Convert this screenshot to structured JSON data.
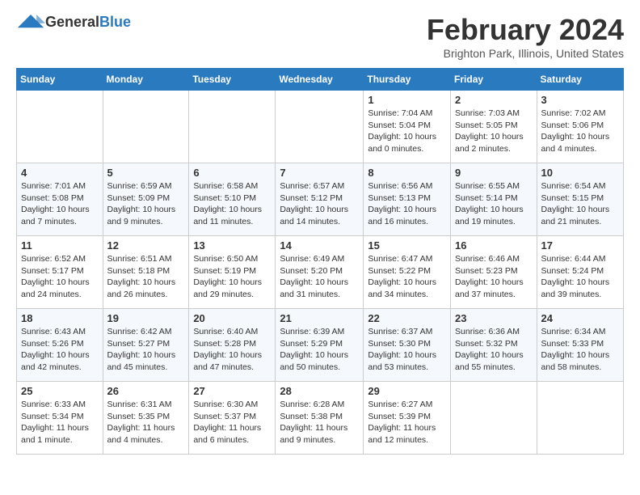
{
  "header": {
    "logo_general": "General",
    "logo_blue": "Blue",
    "title": "February 2024",
    "subtitle": "Brighton Park, Illinois, United States"
  },
  "weekdays": [
    "Sunday",
    "Monday",
    "Tuesday",
    "Wednesday",
    "Thursday",
    "Friday",
    "Saturday"
  ],
  "weeks": [
    [
      {
        "num": "",
        "detail": ""
      },
      {
        "num": "",
        "detail": ""
      },
      {
        "num": "",
        "detail": ""
      },
      {
        "num": "",
        "detail": ""
      },
      {
        "num": "1",
        "detail": "Sunrise: 7:04 AM\nSunset: 5:04 PM\nDaylight: 10 hours\nand 0 minutes."
      },
      {
        "num": "2",
        "detail": "Sunrise: 7:03 AM\nSunset: 5:05 PM\nDaylight: 10 hours\nand 2 minutes."
      },
      {
        "num": "3",
        "detail": "Sunrise: 7:02 AM\nSunset: 5:06 PM\nDaylight: 10 hours\nand 4 minutes."
      }
    ],
    [
      {
        "num": "4",
        "detail": "Sunrise: 7:01 AM\nSunset: 5:08 PM\nDaylight: 10 hours\nand 7 minutes."
      },
      {
        "num": "5",
        "detail": "Sunrise: 6:59 AM\nSunset: 5:09 PM\nDaylight: 10 hours\nand 9 minutes."
      },
      {
        "num": "6",
        "detail": "Sunrise: 6:58 AM\nSunset: 5:10 PM\nDaylight: 10 hours\nand 11 minutes."
      },
      {
        "num": "7",
        "detail": "Sunrise: 6:57 AM\nSunset: 5:12 PM\nDaylight: 10 hours\nand 14 minutes."
      },
      {
        "num": "8",
        "detail": "Sunrise: 6:56 AM\nSunset: 5:13 PM\nDaylight: 10 hours\nand 16 minutes."
      },
      {
        "num": "9",
        "detail": "Sunrise: 6:55 AM\nSunset: 5:14 PM\nDaylight: 10 hours\nand 19 minutes."
      },
      {
        "num": "10",
        "detail": "Sunrise: 6:54 AM\nSunset: 5:15 PM\nDaylight: 10 hours\nand 21 minutes."
      }
    ],
    [
      {
        "num": "11",
        "detail": "Sunrise: 6:52 AM\nSunset: 5:17 PM\nDaylight: 10 hours\nand 24 minutes."
      },
      {
        "num": "12",
        "detail": "Sunrise: 6:51 AM\nSunset: 5:18 PM\nDaylight: 10 hours\nand 26 minutes."
      },
      {
        "num": "13",
        "detail": "Sunrise: 6:50 AM\nSunset: 5:19 PM\nDaylight: 10 hours\nand 29 minutes."
      },
      {
        "num": "14",
        "detail": "Sunrise: 6:49 AM\nSunset: 5:20 PM\nDaylight: 10 hours\nand 31 minutes."
      },
      {
        "num": "15",
        "detail": "Sunrise: 6:47 AM\nSunset: 5:22 PM\nDaylight: 10 hours\nand 34 minutes."
      },
      {
        "num": "16",
        "detail": "Sunrise: 6:46 AM\nSunset: 5:23 PM\nDaylight: 10 hours\nand 37 minutes."
      },
      {
        "num": "17",
        "detail": "Sunrise: 6:44 AM\nSunset: 5:24 PM\nDaylight: 10 hours\nand 39 minutes."
      }
    ],
    [
      {
        "num": "18",
        "detail": "Sunrise: 6:43 AM\nSunset: 5:26 PM\nDaylight: 10 hours\nand 42 minutes."
      },
      {
        "num": "19",
        "detail": "Sunrise: 6:42 AM\nSunset: 5:27 PM\nDaylight: 10 hours\nand 45 minutes."
      },
      {
        "num": "20",
        "detail": "Sunrise: 6:40 AM\nSunset: 5:28 PM\nDaylight: 10 hours\nand 47 minutes."
      },
      {
        "num": "21",
        "detail": "Sunrise: 6:39 AM\nSunset: 5:29 PM\nDaylight: 10 hours\nand 50 minutes."
      },
      {
        "num": "22",
        "detail": "Sunrise: 6:37 AM\nSunset: 5:30 PM\nDaylight: 10 hours\nand 53 minutes."
      },
      {
        "num": "23",
        "detail": "Sunrise: 6:36 AM\nSunset: 5:32 PM\nDaylight: 10 hours\nand 55 minutes."
      },
      {
        "num": "24",
        "detail": "Sunrise: 6:34 AM\nSunset: 5:33 PM\nDaylight: 10 hours\nand 58 minutes."
      }
    ],
    [
      {
        "num": "25",
        "detail": "Sunrise: 6:33 AM\nSunset: 5:34 PM\nDaylight: 11 hours\nand 1 minute."
      },
      {
        "num": "26",
        "detail": "Sunrise: 6:31 AM\nSunset: 5:35 PM\nDaylight: 11 hours\nand 4 minutes."
      },
      {
        "num": "27",
        "detail": "Sunrise: 6:30 AM\nSunset: 5:37 PM\nDaylight: 11 hours\nand 6 minutes."
      },
      {
        "num": "28",
        "detail": "Sunrise: 6:28 AM\nSunset: 5:38 PM\nDaylight: 11 hours\nand 9 minutes."
      },
      {
        "num": "29",
        "detail": "Sunrise: 6:27 AM\nSunset: 5:39 PM\nDaylight: 11 hours\nand 12 minutes."
      },
      {
        "num": "",
        "detail": ""
      },
      {
        "num": "",
        "detail": ""
      }
    ]
  ]
}
